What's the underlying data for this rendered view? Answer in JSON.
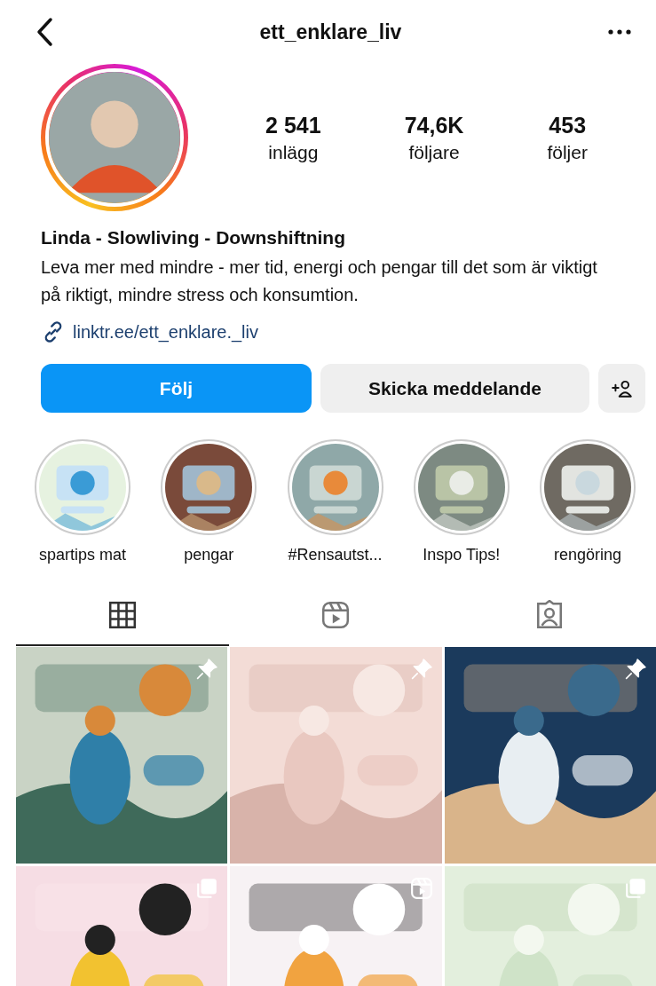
{
  "header": {
    "username": "ett_enklare_liv"
  },
  "profile": {
    "stats": [
      {
        "value": "2 541",
        "label": "inlägg"
      },
      {
        "value": "74,6K",
        "label": "följare"
      },
      {
        "value": "453",
        "label": "följer"
      }
    ],
    "name": "Linda - Slowliving - Downshiftning",
    "bio": "Leva mer med mindre - mer tid, energi och pengar till det som är viktigt på riktigt, mindre stress och konsumtion.",
    "link": "linktr.ee/ett_enklare._liv"
  },
  "buttons": {
    "follow": "Följ",
    "message": "Skicka meddelande"
  },
  "highlights": [
    {
      "label": "spartips mat"
    },
    {
      "label": "pengar"
    },
    {
      "label": "#Rensautst..."
    },
    {
      "label": "Inspo Tips!"
    },
    {
      "label": "rengöring"
    }
  ],
  "tabs": [
    {
      "kind": "grid",
      "selected": true
    },
    {
      "kind": "reels",
      "selected": false
    },
    {
      "kind": "tagged",
      "selected": false
    }
  ],
  "posts": [
    {
      "kind": "pinned"
    },
    {
      "kind": "pinned"
    },
    {
      "kind": "pinned"
    },
    {
      "kind": "carousel"
    },
    {
      "kind": "reel"
    },
    {
      "kind": "carousel"
    }
  ]
}
